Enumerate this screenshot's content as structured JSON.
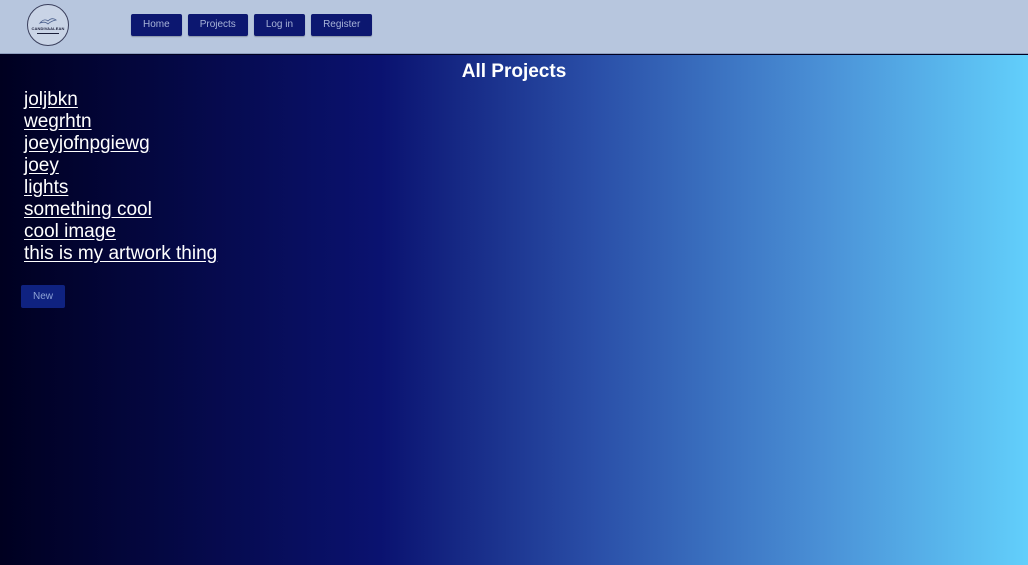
{
  "header": {
    "logo_text": "CANDIVAALEAN",
    "nav": [
      {
        "label": "Home"
      },
      {
        "label": "Projects"
      },
      {
        "label": "Log in"
      },
      {
        "label": "Register"
      }
    ]
  },
  "main": {
    "title": "All Projects",
    "projects": [
      {
        "name": "joljbkn"
      },
      {
        "name": "wegrhtn"
      },
      {
        "name": "joeyjofnpgiewg"
      },
      {
        "name": "joey"
      },
      {
        "name": "lights"
      },
      {
        "name": "something cool"
      },
      {
        "name": "cool image"
      },
      {
        "name": "this is my artwork thing"
      }
    ],
    "new_label": "New"
  },
  "colors": {
    "header_bg": "#b7c6de",
    "nav_button_bg": "#0c1770",
    "gradient_start": "#000020",
    "gradient_end": "#62cffb"
  }
}
